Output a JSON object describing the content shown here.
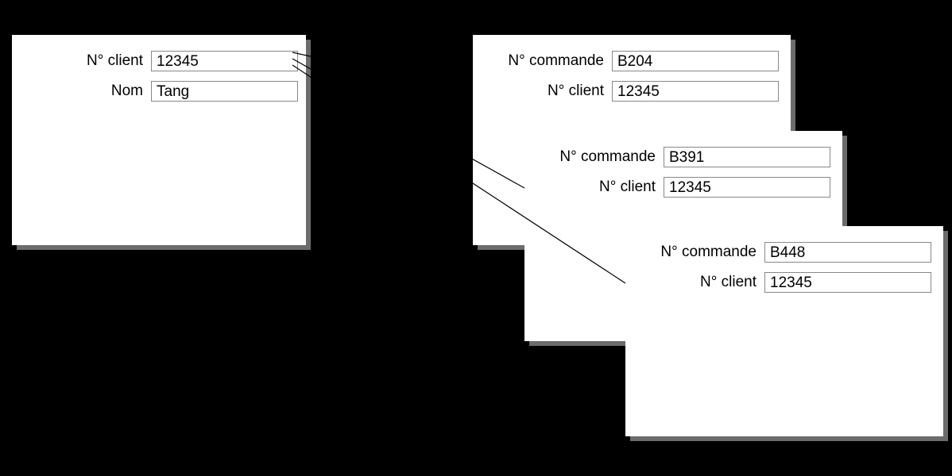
{
  "labels": {
    "client_id": "N° client",
    "name": "Nom",
    "order_id": "N° commande"
  },
  "client": {
    "id": "12345",
    "name": "Tang"
  },
  "orders": [
    {
      "order_id": "B204",
      "client_id": "12345"
    },
    {
      "order_id": "B391",
      "client_id": "12345"
    },
    {
      "order_id": "B448",
      "client_id": "12345"
    }
  ]
}
